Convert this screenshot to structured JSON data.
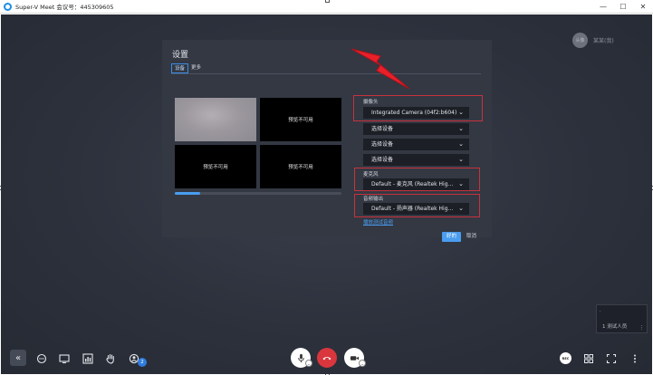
{
  "window": {
    "title": "Super-V Meet 会议号：445309605",
    "minimize": "—",
    "maximize": "☐",
    "close": "✕"
  },
  "presenter": {
    "avatar_text": "头像",
    "name": "某某(我)"
  },
  "thumbnail": {
    "label": "1 测试人员",
    "dot": "·",
    "corner": "⋮"
  },
  "dialog": {
    "title": "设置",
    "tabs": [
      {
        "label": "设备",
        "active": true
      },
      {
        "label": "更多",
        "active": false
      }
    ],
    "preview_cells": [
      "",
      "预览不可用",
      "预览不可用",
      "预览不可用"
    ],
    "preview_progress": 0.15,
    "camera_label": "摄像头",
    "camera_selected": "Integrated Camera (04f2:b604)",
    "extra_camera_selects": [
      "选择设备",
      "选择设备",
      "选择设备"
    ],
    "mic_label": "麦克风",
    "mic_selected": "Default - 麦克风 (Realtek Hig...",
    "speaker_label": "音频输出",
    "speaker_selected": "Default - 扬声器 (Realtek Hig...",
    "test_link": "播放测试音频",
    "ok": "好的",
    "cancel": "取消"
  },
  "toolbar": {
    "collapse": "«",
    "participants_badge": "2",
    "rec": "REC"
  },
  "colors": {
    "accent": "#4a9df0",
    "hangup": "#d9363e",
    "highlight": "#c8323d",
    "bolt": "#e8202a"
  }
}
